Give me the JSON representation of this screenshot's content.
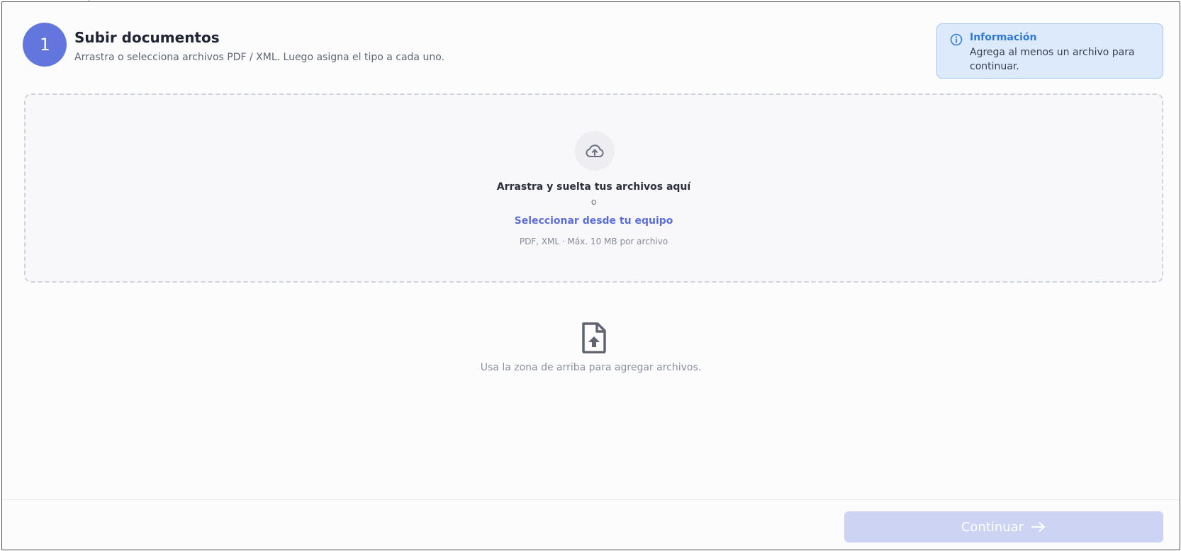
{
  "header": {
    "step_number": "1",
    "title": "Subir documentos",
    "subtitle": "Arrastra o selecciona archivos PDF / XML. Luego asigna el tipo a cada uno."
  },
  "info": {
    "icon": "info-icon",
    "title": "Información",
    "text": "Agrega al menos un archivo para continuar."
  },
  "dropzone": {
    "icon": "cloud-upload-icon",
    "title": "Arrastra y suelta tus archivos aquí",
    "or_text": "o",
    "select_link": "Seleccionar desde tu equipo",
    "hint": "PDF, XML · Máx. 10 MB por archivo"
  },
  "empty_state": {
    "icon": "file-upload-icon",
    "text": "Usa la zona de arriba para agregar archivos."
  },
  "footer": {
    "continue_label": "Continuar",
    "continue_icon": "arrow-right-icon"
  },
  "colors": {
    "accent": "#6276de",
    "link": "#5b6ed8",
    "info_bg": "#dceafc",
    "info_title": "#2f7ad6",
    "button_disabled": "#cdd4f3"
  }
}
